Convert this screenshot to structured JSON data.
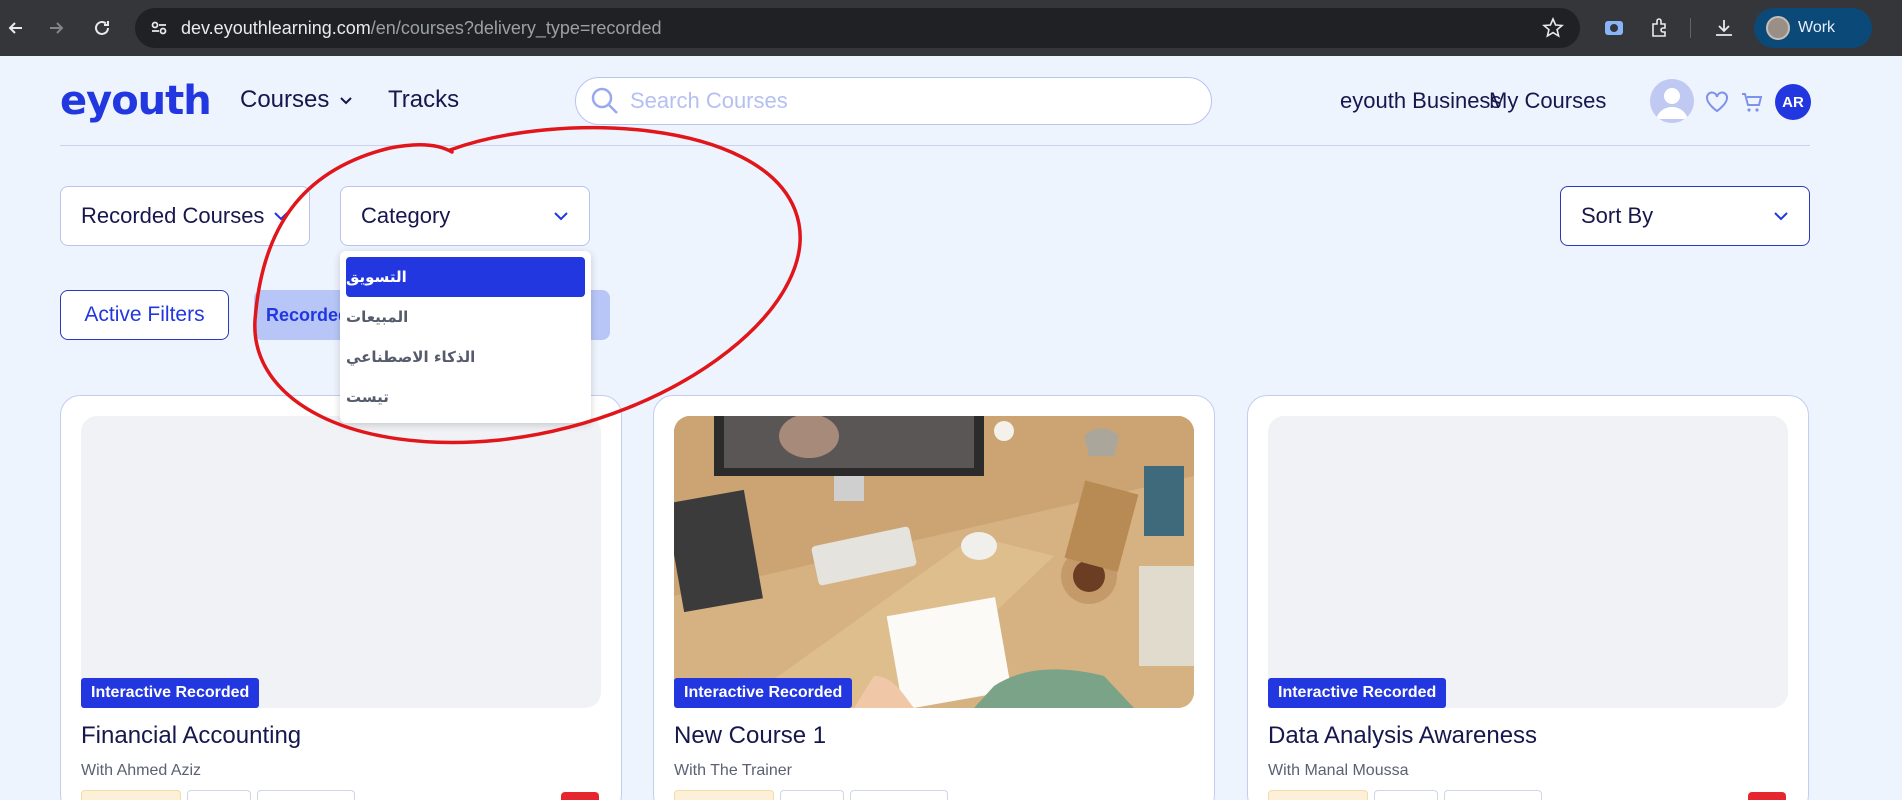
{
  "browser": {
    "url_host": "dev.eyouthlearning.com",
    "url_path": "/en/courses?delivery_type=recorded",
    "profile_label": "Work"
  },
  "header": {
    "logo": "eyouth",
    "nav": {
      "courses": "Courses",
      "tracks": "Tracks"
    },
    "search_placeholder": "Search Courses",
    "business_link": "eyouth Business",
    "my_courses_link": "My Courses",
    "lang_badge": "AR"
  },
  "filters": {
    "delivery_select": "Recorded Courses",
    "category_select": "Category",
    "sort_select": "Sort By",
    "active_filters_label": "Active Filters",
    "recorded_chip": "Recorded",
    "category_options": [
      {
        "label": "التسويق",
        "selected": true
      },
      {
        "label": "المبيعات",
        "selected": false
      },
      {
        "label": "الذكاء الاصطناعي",
        "selected": false
      },
      {
        "label": "تيست",
        "selected": false
      }
    ]
  },
  "courses": [
    {
      "badge": "Interactive Recorded",
      "title": "Financial Accounting",
      "instructor": "With Ahmed Aziz",
      "has_image": false
    },
    {
      "badge": "Interactive Recorded",
      "title": "New Course 1",
      "instructor": "With The Trainer",
      "has_image": true
    },
    {
      "badge": "Interactive Recorded",
      "title": "Data Analysis Awareness",
      "instructor": "With Manal Moussa",
      "has_image": false
    }
  ],
  "colors": {
    "brand": "#2237e0",
    "background": "#eef4fd",
    "annotation": "#e0161b"
  }
}
